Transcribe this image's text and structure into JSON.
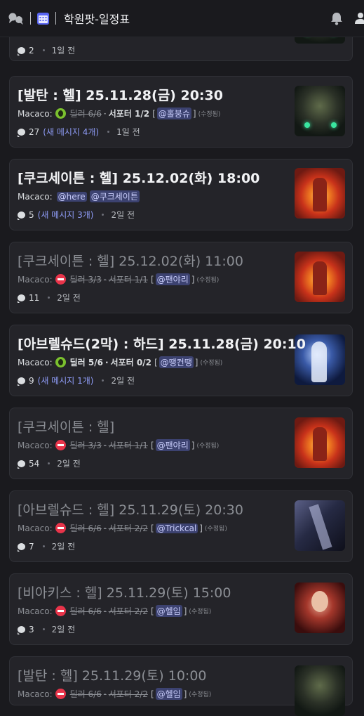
{
  "header": {
    "title": "학원팟-일정표",
    "icons": [
      "forum-icon",
      "calendar-icon",
      "bell-icon",
      "members-icon"
    ]
  },
  "cards": [
    {
      "title": "",
      "dim": false,
      "author": "",
      "footer": {
        "count": "2",
        "new": "",
        "time": "1일 전"
      },
      "thumb": "orc"
    },
    {
      "title": "[발탄 : 헬] 25.11.28(금) 20:30",
      "dim": false,
      "author": "Macaco:",
      "status": "ok",
      "dealer": "딜러 6/6",
      "dealer_strike": true,
      "middot": "·",
      "support": "서포터 1/2",
      "support_strike": false,
      "mention": "@홀붕슈",
      "edited": "(수정됨)",
      "footer": {
        "count": "27",
        "new": "(새 메시지 4개)",
        "time": "1일 전"
      },
      "thumb": "orc"
    },
    {
      "title": "[쿠크세이튼 : 헬] 25.12.02(화) 18:00",
      "dim": false,
      "author": "Macaco:",
      "mentions": [
        "@here",
        "@쿠크세이튼"
      ],
      "footer": {
        "count": "5",
        "new": "(새 메시지 3개)",
        "time": "2일 전"
      },
      "thumb": "fire"
    },
    {
      "title": "[쿠크세이튼 : 헬] 25.12.02(화) 11:00",
      "dim": true,
      "author": "Macaco:",
      "status": "no",
      "dealer": "딜러 3/3",
      "dealer_strike": true,
      "middot": "·",
      "support": "서포터 1/1",
      "support_strike": true,
      "mention": "@팬야리",
      "edited": "(수정됨)",
      "footer": {
        "count": "11",
        "new": "",
        "time": "2일 전"
      },
      "thumb": "fire"
    },
    {
      "title": "[아브렐슈드(2막) : 하드] 25.11.28(금) 20:10",
      "dim": false,
      "author": "Macaco:",
      "status": "ok",
      "dealer": "딜러 5/6",
      "dealer_strike": false,
      "middot": "·",
      "support": "서포터 0/2",
      "support_strike": false,
      "mention": "@땡컨땡",
      "edited": "(수정됨)",
      "footer": {
        "count": "9",
        "new": "(새 메시지 1개)",
        "time": "2일 전"
      },
      "thumb": "blue"
    },
    {
      "title": "[쿠크세이튼 : 헬]",
      "dim": true,
      "author": "Macaco:",
      "status": "no",
      "dealer": "딜러 3/3",
      "dealer_strike": true,
      "middot": "·",
      "support": "서포터 1/1",
      "support_strike": true,
      "mention": "@팬야리",
      "edited": "(수정됨)",
      "footer": {
        "count": "54",
        "new": "",
        "time": "2일 전"
      },
      "thumb": "fire"
    },
    {
      "title": "[아브렐슈드 : 헬] 25.11.29(토) 20:30",
      "dim": true,
      "author": "Macaco:",
      "status": "no",
      "dealer": "딜러 6/6",
      "dealer_strike": true,
      "middot": "·",
      "support": "서포터 2/2",
      "support_strike": true,
      "mention": "@Trickcal",
      "edited": "(수정됨)",
      "footer": {
        "count": "7",
        "new": "",
        "time": "2일 전"
      },
      "thumb": "dark"
    },
    {
      "title": "[비아키스 : 헬] 25.11.29(토) 15:00",
      "dim": true,
      "author": "Macaco:",
      "status": "no",
      "dealer": "딜러 6/6",
      "dealer_strike": true,
      "middot": "·",
      "support": "서포터 2/2",
      "support_strike": true,
      "mention": "@헬임",
      "edited": "(수정됨)",
      "footer": {
        "count": "3",
        "new": "",
        "time": "2일 전"
      },
      "thumb": "red"
    },
    {
      "title": "[발탄 : 헬] 25.11.29(토) 10:00",
      "dim": true,
      "author": "Macaco:",
      "status": "no",
      "dealer": "딜러 6/6",
      "dealer_strike": true,
      "middot": "·",
      "support": "서포터 2/2",
      "support_strike": true,
      "mention": "@헬임",
      "edited": "(수정됨)",
      "footer": {
        "count": "",
        "new": "",
        "time": ""
      },
      "thumb": "orc"
    }
  ]
}
